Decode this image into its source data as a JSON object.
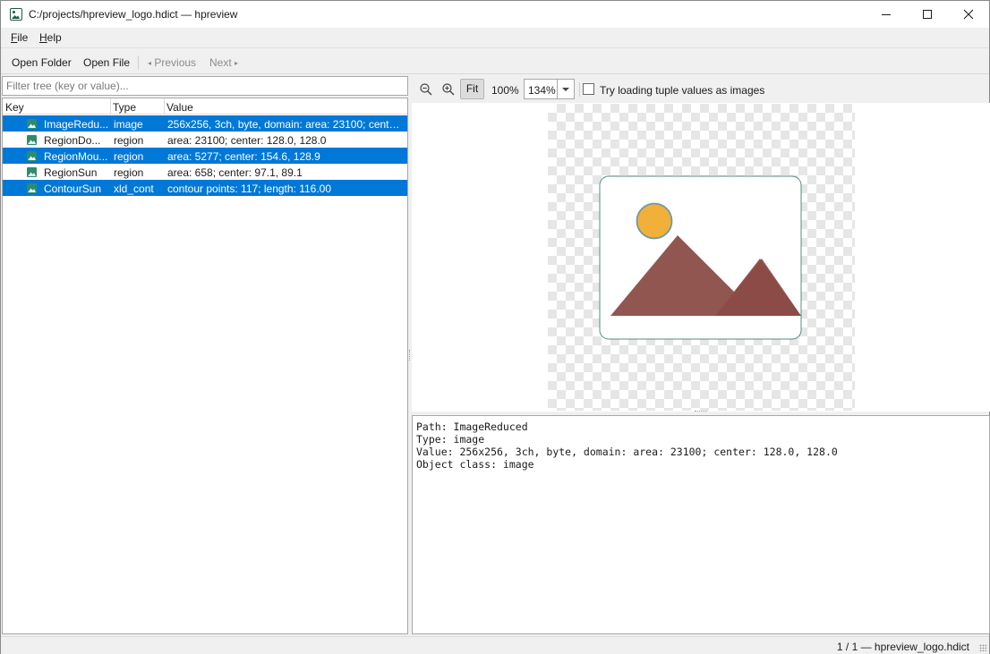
{
  "window": {
    "title": "C:/projects/hpreview_logo.hdict — hpreview",
    "icon": "image-app-icon"
  },
  "menu": {
    "file": "File",
    "help": "Help"
  },
  "toolbar": {
    "open_folder": "Open Folder",
    "open_file": "Open File",
    "previous": "Previous",
    "next": "Next",
    "prev_arrow": "◂",
    "next_arrow": "▸"
  },
  "filter": {
    "placeholder": "Filter tree (key or value)..."
  },
  "tree": {
    "columns": [
      "Key",
      "Type",
      "Value"
    ],
    "rows": [
      {
        "key": "ImageRedu...",
        "type": "image",
        "value": "256x256, 3ch, byte, domain: area: 23100; center: ...",
        "selected": true
      },
      {
        "key": "RegionDo...",
        "type": "region",
        "value": "area: 23100; center: 128.0, 128.0",
        "selected": false
      },
      {
        "key": "RegionMou...",
        "type": "region",
        "value": "area: 5277; center: 154.6, 128.9",
        "selected": true
      },
      {
        "key": "RegionSun",
        "type": "region",
        "value": "area: 658; center: 97.1, 89.1",
        "selected": false
      },
      {
        "key": "ContourSun",
        "type": "xld_cont",
        "value": "contour points: 117; length: 116.00",
        "selected": true
      }
    ]
  },
  "viewer": {
    "fit": "Fit",
    "zoom_100": "100%",
    "zoom_value": "134%",
    "tuple_label": "Try loading tuple values as images",
    "tuple_checked": false,
    "colors": {
      "sun": "#f0b03a",
      "mountain": "#925650",
      "accent": "#0078d7"
    }
  },
  "details": {
    "lines": [
      "Path: ImageReduced",
      "Type: image",
      "Value: 256x256, 3ch, byte, domain: area: 23100; center: 128.0, 128.0",
      "Object class: image"
    ]
  },
  "status": {
    "text": "1 / 1 — hpreview_logo.hdict"
  }
}
